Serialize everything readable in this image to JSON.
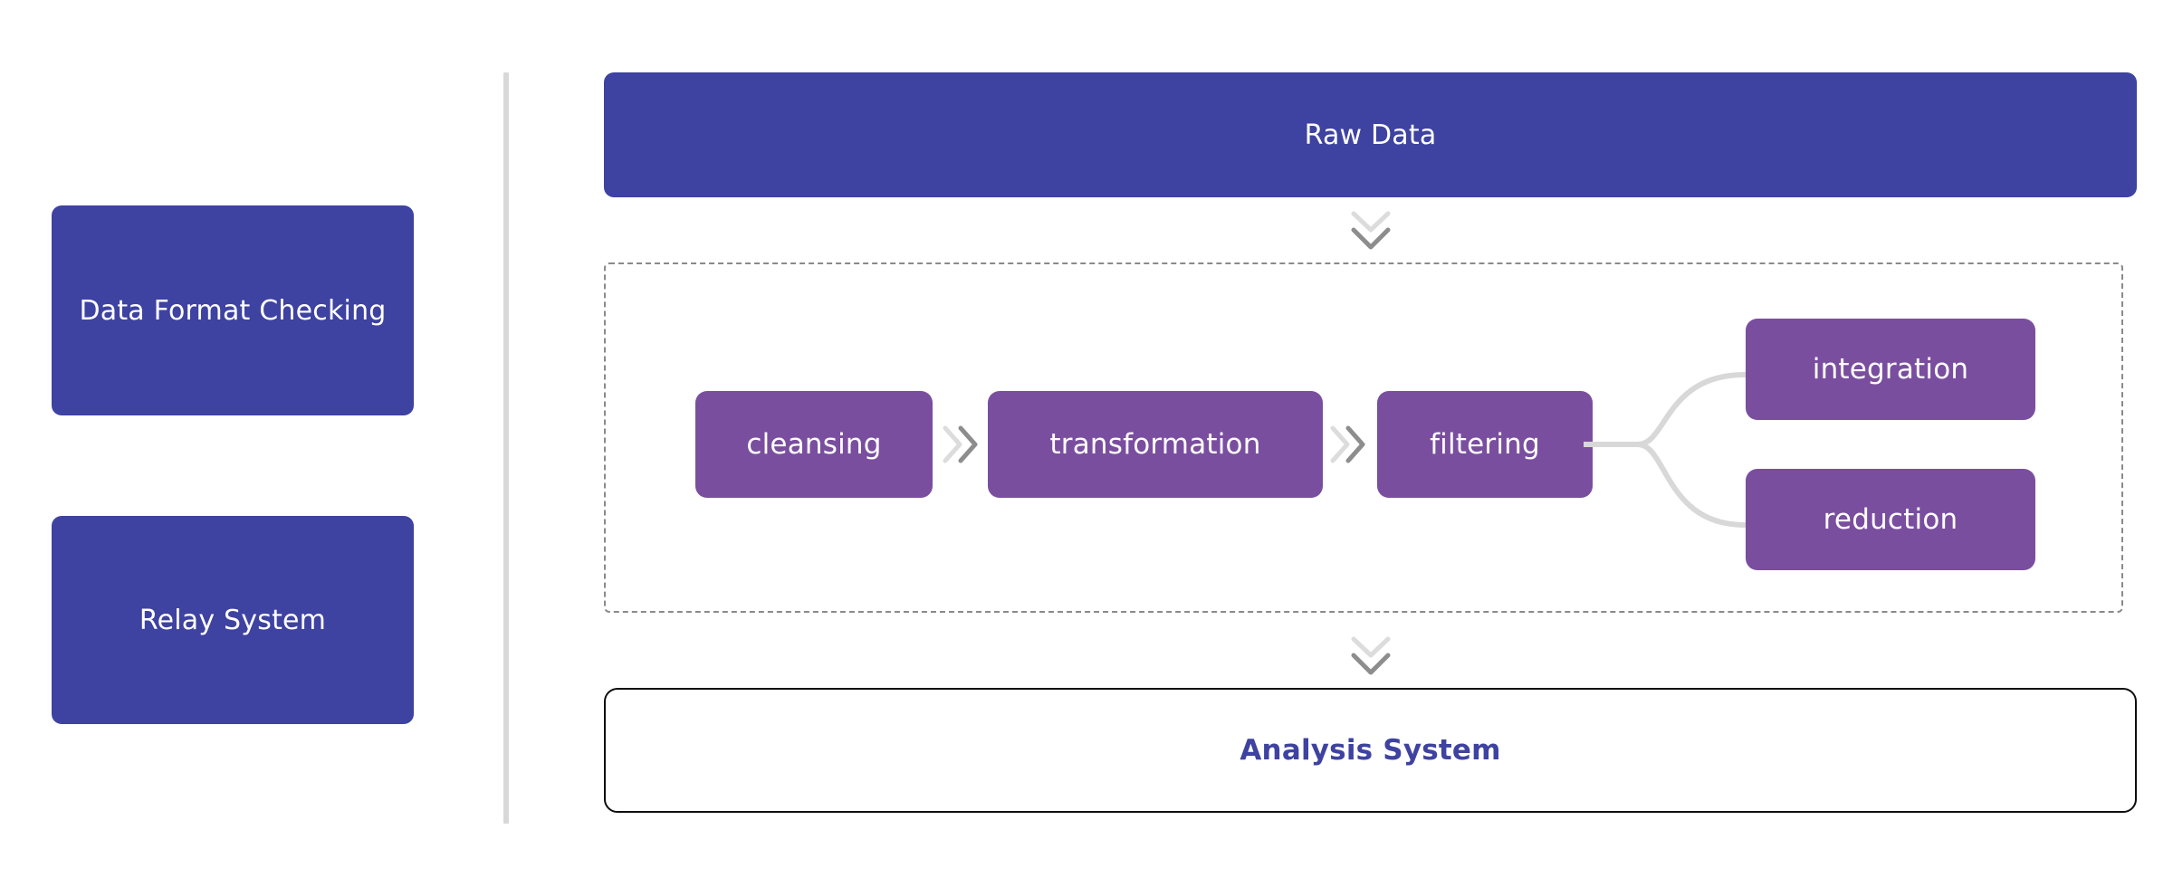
{
  "diagram": {
    "title": "Data processing pipeline flow",
    "colors": {
      "indigo": "#3e42a0",
      "purple": "#7a4e9f",
      "divider_gray": "#d8d8d8",
      "dashed_gray": "#8a8a8a",
      "connector_gray": "#d5d5d5",
      "outline_black": "#0e0e0e",
      "text_white": "#ffffff"
    }
  },
  "sidebar": {
    "items": [
      {
        "label": "Data Format Checking",
        "icon": "rounded-box"
      },
      {
        "label": "Relay System",
        "icon": "rounded-box"
      }
    ]
  },
  "divider": {
    "icon": "vertical-divider"
  },
  "flow": {
    "source": {
      "label": "Raw Data"
    },
    "connector_top": {
      "icon": "double-chevron-down-icon"
    },
    "connector_bottom": {
      "icon": "double-chevron-down-icon"
    },
    "pipeline": {
      "steps": [
        {
          "label": "cleansing"
        },
        {
          "label": "transformation"
        },
        {
          "label": "filtering"
        }
      ],
      "separators": [
        {
          "icon": "double-chevron-right-icon"
        },
        {
          "icon": "double-chevron-right-icon"
        }
      ],
      "branches": [
        {
          "label": "integration"
        },
        {
          "label": "reduction"
        }
      ],
      "branch_connector": {
        "icon": "curved-branch-connector"
      }
    },
    "sink": {
      "label": "Analysis System"
    }
  }
}
